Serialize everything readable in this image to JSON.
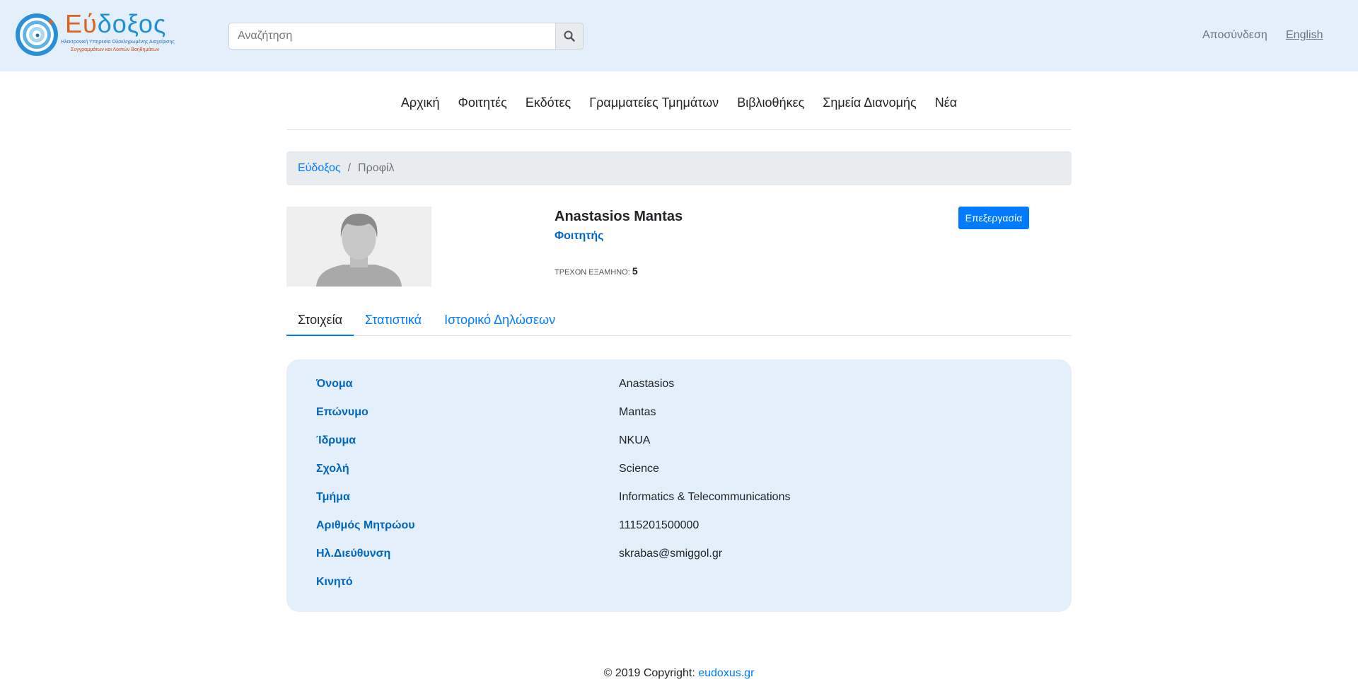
{
  "header": {
    "logo_title_part1": "Εύ",
    "logo_title_part2": "δοξος",
    "logo_subtitle_line1": "Ηλεκτρονική Υπηρεσία Ολοκληρωμένης Διαχείρισης",
    "logo_subtitle_line2": "Συγγραμμάτων και Λοιπών Βοηθημάτων",
    "search_placeholder": "Αναζήτηση",
    "logout_label": "Αποσύνδεση",
    "language_label": "English"
  },
  "nav": {
    "items": [
      "Αρχική",
      "Φοιτητές",
      "Εκδότες",
      "Γραμματείες Τμημάτων",
      "Βιβλιοθήκες",
      "Σημεία Διανομής",
      "Νέα"
    ]
  },
  "breadcrumb": {
    "root": "Εύδοξος",
    "separator": "/",
    "current": "Προφίλ"
  },
  "profile": {
    "name": "Anastasios Mantas",
    "role": "Φοιτητής",
    "semester_label": "ΤΡΕΧΟΝ ΕΞΑΜΗΝΟ:",
    "semester_value": "5",
    "edit_label": "Επεξεργασία"
  },
  "tabs": [
    "Στοιχεία",
    "Στατιστικά",
    "Ιστορικό Δηλώσεων"
  ],
  "details": [
    {
      "label": "Όνομα",
      "value": "Anastasios"
    },
    {
      "label": "Επώνυμο",
      "value": "Mantas"
    },
    {
      "label": "Ίδρυμα",
      "value": "NKUA"
    },
    {
      "label": "Σχολή",
      "value": "Science"
    },
    {
      "label": "Τμήμα",
      "value": "Informatics & Telecommunications"
    },
    {
      "label": "Αριθμός Μητρώου",
      "value": "1115201500000"
    },
    {
      "label": "Ηλ.Διεύθυνση",
      "value": "skrabas@smiggol.gr"
    },
    {
      "label": "Κινητό",
      "value": ""
    }
  ],
  "footer": {
    "text": "© 2019 Copyright:",
    "link": "eudoxus.gr"
  },
  "colors": {
    "header_bg": "#e3effa",
    "accent": "#007bff",
    "label_blue": "#0066c0"
  }
}
